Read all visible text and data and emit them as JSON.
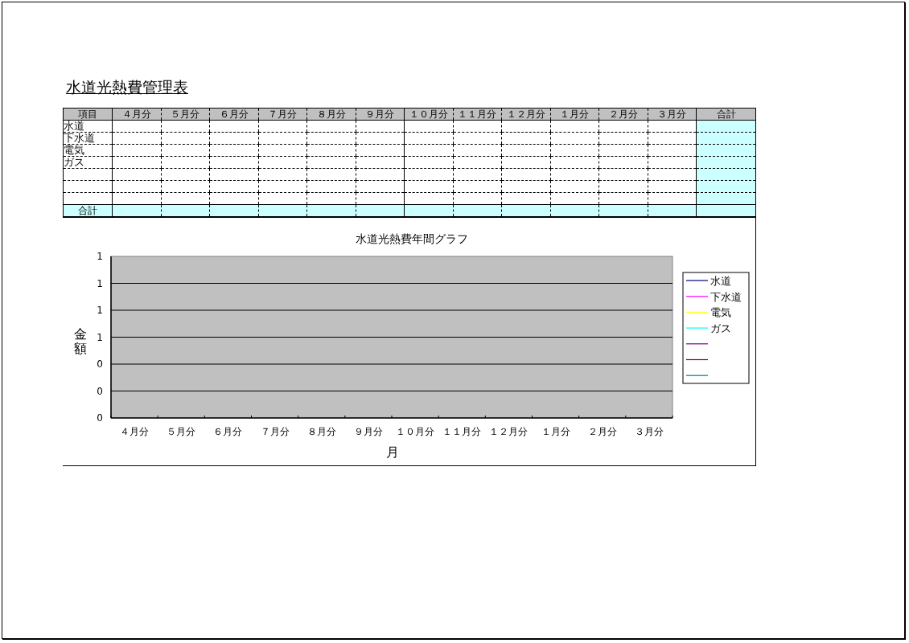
{
  "sheet": {
    "title": "水道光熱費管理表",
    "table": {
      "columns": [
        "項目",
        "４月分",
        "５月分",
        "６月分",
        "７月分",
        "８月分",
        "９月分",
        "１０月分",
        "１１月分",
        "１２月分",
        "１月分",
        "２月分",
        "３月分",
        "合計"
      ],
      "rows": [
        "水道",
        "下水道",
        "電気",
        "ガス",
        null,
        null,
        null
      ],
      "total_label": "合計"
    },
    "chart": {
      "chart_data": {
        "type": "line",
        "title": "水道光熱費年間グラフ",
        "xlabel": "月",
        "ylabel": "金額",
        "categories": [
          "４月分",
          "５月分",
          "６月分",
          "７月分",
          "８月分",
          "９月分",
          "１０月分",
          "１１月分",
          "１２月分",
          "１月分",
          "２月分",
          "３月分"
        ],
        "series": [
          {
            "name": "水道",
            "color": "#000080",
            "values": [
              null,
              null,
              null,
              null,
              null,
              null,
              null,
              null,
              null,
              null,
              null,
              null
            ]
          },
          {
            "name": "下水道",
            "color": "#ff00ff",
            "values": [
              null,
              null,
              null,
              null,
              null,
              null,
              null,
              null,
              null,
              null,
              null,
              null
            ]
          },
          {
            "name": "電気",
            "color": "#ffff00",
            "values": [
              null,
              null,
              null,
              null,
              null,
              null,
              null,
              null,
              null,
              null,
              null,
              null
            ]
          },
          {
            "name": "ガス",
            "color": "#00ffff",
            "values": [
              null,
              null,
              null,
              null,
              null,
              null,
              null,
              null,
              null,
              null,
              null,
              null
            ]
          },
          {
            "color": "#800080",
            "values": [
              null,
              null,
              null,
              null,
              null,
              null,
              null,
              null,
              null,
              null,
              null,
              null
            ]
          },
          {
            "color": "#800000",
            "values": [
              null,
              null,
              null,
              null,
              null,
              null,
              null,
              null,
              null,
              null,
              null,
              null
            ]
          },
          {
            "color": "#008080",
            "values": [
              null,
              null,
              null,
              null,
              null,
              null,
              null,
              null,
              null,
              null,
              null,
              null
            ]
          }
        ],
        "ylim": [
          0,
          1.2
        ],
        "grid": true,
        "yticks": [
          {
            "value": 0,
            "label": "0"
          },
          {
            "value": 0.2,
            "label": "0"
          },
          {
            "value": 0.4,
            "label": "0"
          },
          {
            "value": 0.6,
            "label": "1"
          },
          {
            "value": 0.8,
            "label": "1"
          },
          {
            "value": 1,
            "label": "1"
          },
          {
            "value": 1.2,
            "label": "1"
          }
        ]
      }
    }
  }
}
